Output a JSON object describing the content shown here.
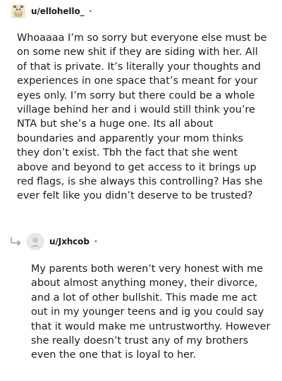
{
  "comments": [
    {
      "author": "u/ellohello_",
      "separator": "•",
      "text": "Whoaaaa I’m so sorry but everyone else must be on some new shit if they are siding with her. All of that is private. It’s literally your thoughts and experiences in one space that’s meant for your eyes only. I’m sorry but there could be a whole village behind her and i would still think you’re NTA but she’s a huge one. Its all about boundaries and apparently your mom thinks they don’t exist. Tbh the fact that she went above and beyond to get access to it brings up red flags, is she always this controlling? Has she ever felt like you didn’t deserve to be trusted?"
    },
    {
      "author": "u/Jxhcob",
      "separator": "•",
      "text": "My parents both weren’t very honest with me about almost anything money, their divorce, and a lot of other bullshit. This made me act out in my younger teens and ig you could say that it would make me untrustworthy. However she really doesn’t trust any of my brothers even the one that is loyal to her."
    }
  ],
  "icons": {
    "first_avatar": "snoo-avatar-icon",
    "second_avatar": "default-avatar-icon",
    "reply": "reply-arrow-icon"
  },
  "colors": {
    "text": "#1c1c1c",
    "muted": "#7c7c7c",
    "reply_arrow": "#9b9b9b"
  }
}
